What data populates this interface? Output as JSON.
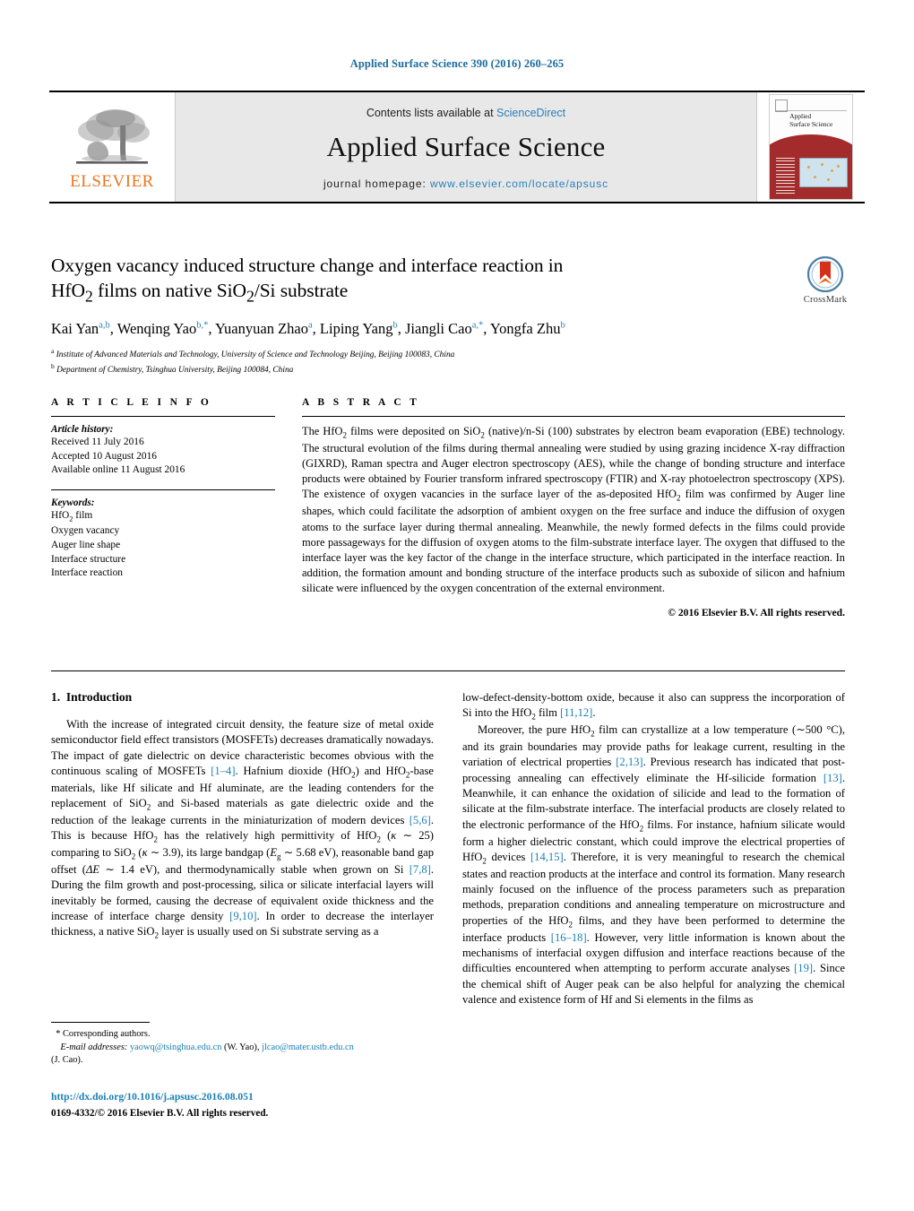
{
  "running_head": "Applied Surface Science 390 (2016) 260–265",
  "masthead": {
    "publisher_logo_text": "ELSEVIER",
    "contents_prefix": "Contents lists available at ",
    "contents_link": "ScienceDirect",
    "journal_name": "Applied Surface Science",
    "homepage_prefix": "journal homepage: ",
    "homepage_url": "www.elsevier.com/locate/apsusc",
    "cover_title_line1": "Applied",
    "cover_title_line2": "Surface Science"
  },
  "crossmark": {
    "label": "CrossMark"
  },
  "article": {
    "title_line1": "Oxygen vacancy induced structure change and interface reaction in",
    "title_line2_a": "HfO",
    "title_line2_sub": "2",
    "title_line2_b": " films on native SiO",
    "title_line2_sub2": "2",
    "title_line2_c": "/Si substrate",
    "authors": [
      {
        "name": "Kai Yan",
        "sup": "a,b",
        "sep": ", "
      },
      {
        "name": "Wenqing Yao",
        "sup": "b,*",
        "sep": ", "
      },
      {
        "name": "Yuanyuan Zhao",
        "sup": "a",
        "sep": ", "
      },
      {
        "name": "Liping Yang",
        "sup": "b",
        "sep": ", "
      },
      {
        "name": "Jiangli Cao",
        "sup": "a,*",
        "sep": ", "
      },
      {
        "name": "Yongfa Zhu",
        "sup": "b",
        "sep": ""
      }
    ],
    "affiliations": [
      {
        "marker": "a",
        "text": "Institute of Advanced Materials and Technology, University of Science and Technology Beijing, Beijing 100083, China"
      },
      {
        "marker": "b",
        "text": "Department of Chemistry, Tsinghua University, Beijing 100084, China"
      }
    ]
  },
  "article_info": {
    "heading": "A R T I C L E   I N F O",
    "history_title": "Article history:",
    "history": [
      "Received 11 July 2016",
      "Accepted 10 August 2016",
      "Available online 11 August 2016"
    ],
    "keywords_title": "Keywords:",
    "keywords": [
      {
        "pre": "HfO",
        "sub": "2",
        "post": " film"
      },
      {
        "pre": "Oxygen vacancy",
        "sub": "",
        "post": ""
      },
      {
        "pre": "Auger line shape",
        "sub": "",
        "post": ""
      },
      {
        "pre": "Interface structure",
        "sub": "",
        "post": ""
      },
      {
        "pre": "Interface reaction",
        "sub": "",
        "post": ""
      }
    ]
  },
  "abstract": {
    "heading": "A B S T R A C T",
    "text": "The HfO2 films were deposited on SiO2 (native)/n-Si (100) substrates by electron beam evaporation (EBE) technology. The structural evolution of the films during thermal annealing were studied by using grazing incidence X-ray diffraction (GIXRD), Raman spectra and Auger electron spectroscopy (AES), while the change of bonding structure and interface products were obtained by Fourier transform infrared spectroscopy (FTIR) and X-ray photoelectron spectroscopy (XPS). The existence of oxygen vacancies in the surface layer of the as-deposited HfO2 film was confirmed by Auger line shapes, which could facilitate the adsorption of ambient oxygen on the free surface and induce the diffusion of oxygen atoms to the surface layer during thermal annealing. Meanwhile, the newly formed defects in the films could provide more passageways for the diffusion of oxygen atoms to the film-substrate interface layer. The oxygen that diffused to the interface layer was the key factor of the change in the interface structure, which participated in the interface reaction. In addition, the formation amount and bonding structure of the interface products such as suboxide of silicon and hafnium silicate were influenced by the oxygen concentration of the external environment.",
    "copyright": "© 2016 Elsevier B.V. All rights reserved."
  },
  "introduction": {
    "section_number": "1.",
    "section_title": "Introduction",
    "para1_part1": "With the increase of integrated circuit density, the feature size of metal oxide semiconductor field effect transistors (MOSFETs) decreases dramatically nowadays. The impact of gate dielectric on device characteristic becomes obvious with the continuous scaling of MOSFETs ",
    "ref_1_4": "[1–4]",
    "para1_part2": ". Hafnium dioxide (HfO",
    "para1_part3": ") and HfO",
    "para1_part4": "-base materials, like Hf silicate and Hf aluminate, are the leading contenders for the replacement of SiO",
    "para1_part5": " and Si-based materials as gate dielectric oxide and the reduction of the leakage currents in the miniaturization of modern devices ",
    "ref_5_6": "[5,6]",
    "para1_part6": ". This is because HfO",
    "para1_part7": " has the relatively high permittivity of HfO",
    "para1_part8": " (κ ∼ 25) comparing to SiO",
    "para1_part9": " (κ ∼ 3.9), its large bandgap (",
    "eg_symbol": "E",
    "eg_sub": "g",
    "para1_part10": " ∼ 5.68 eV), reasonable band gap offset (",
    "delta_e": "ΔE",
    "para1_part11": " ∼ 1.4 eV), and thermodynamically stable when grown on Si ",
    "ref_7_8": "[7,8]",
    "para1_part12": ". During the film growth and post-processing, silica or silicate interfacial layers will inevitably be formed, causing the decrease of equivalent oxide thickness and the increase of interface charge density ",
    "ref_9_10": "[9,10]",
    "para1_part13": ". In order to decrease the interlayer thickness, a native SiO",
    "para1_part14": " layer is usually used on Si substrate serving as a low-defect-density-bottom oxide, because it also can suppress the incorporation of Si into the HfO",
    "para1_part15": " film ",
    "ref_11_12": "[11,12]",
    "para1_part16": ".",
    "para2_part1": "Moreover, the pure HfO",
    "para2_part2": " film can crystallize at a low temperature (∼500 °C), and its grain boundaries may provide paths for leakage current, resulting in the variation of electrical properties ",
    "ref_2_13": "[2,13]",
    "para2_part3": ". Previous research has indicated that post-processing annealing can effectively eliminate the Hf-silicide formation ",
    "ref_13": "[13]",
    "para2_part4": ". Meanwhile, it can enhance the oxidation of silicide and lead to the formation of silicate at the film-substrate interface. The interfacial products are closely related to the electronic performance of the HfO",
    "para2_part5": " films. For instance, hafnium silicate would form a higher dielectric constant, which could improve the electrical properties of HfO",
    "para2_part6": " devices ",
    "ref_14_15": "[14,15]",
    "para2_part7": ". Therefore, it is very meaningful to research the chemical states and reaction products at the interface and control its formation. Many research mainly focused on the influence of the process parameters such as preparation methods, preparation conditions and annealing temperature on microstructure and properties of the HfO",
    "para2_part8": " films, and they have been performed to determine the interface products ",
    "ref_16_18": "[16–18]",
    "para2_part9": ". However, very little information is known about the mechanisms of interfacial oxygen diffusion and interface reactions because of the difficulties encountered when attempting to perform accurate analyses ",
    "ref_19": "[19]",
    "para2_part10": ". Since the chemical shift of Auger peak can be also helpful for analyzing the chemical valence and existence form of Hf and Si elements in the films as"
  },
  "footnotes": {
    "star": "*",
    "corresponding": " Corresponding authors.",
    "email_label": "E-mail addresses:",
    "email1": "yaowq@tsinghua.edu.cn",
    "email1_owner": " (W. Yao), ",
    "email2": "jlcao@mater.ustb.edu.cn",
    "email2_owner": "(J. Cao)."
  },
  "footer": {
    "doi": "http://dx.doi.org/10.1016/j.apsusc.2016.08.051",
    "issn": "0169-4332/© 2016 Elsevier B.V. All rights reserved."
  },
  "colors": {
    "link": "#1b7fb5",
    "header_blue": "#1b6b9c",
    "elsevier_orange": "#E87722",
    "masthead_bg": "#e8e8e8",
    "cover_red": "#a32b2b"
  }
}
